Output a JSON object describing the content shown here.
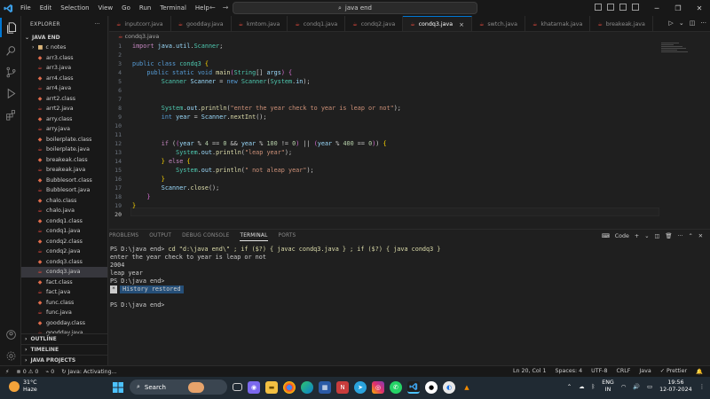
{
  "titlebar": {
    "menu": [
      "File",
      "Edit",
      "Selection",
      "View",
      "Go",
      "Run",
      "Terminal",
      "Help"
    ],
    "search_text": "java end"
  },
  "sidebar": {
    "header": "EXPLORER",
    "root": "JAVA END",
    "folder": "c notes",
    "files": [
      {
        "name": "arr3.class",
        "kind": "class"
      },
      {
        "name": "arr3.java",
        "kind": "java"
      },
      {
        "name": "arr4.class",
        "kind": "class"
      },
      {
        "name": "arr4.java",
        "kind": "java"
      },
      {
        "name": "arrt2.class",
        "kind": "class"
      },
      {
        "name": "arrt2.java",
        "kind": "java"
      },
      {
        "name": "arry.class",
        "kind": "class"
      },
      {
        "name": "arry.java",
        "kind": "java"
      },
      {
        "name": "boilerplate.class",
        "kind": "class"
      },
      {
        "name": "boilerplate.java",
        "kind": "java"
      },
      {
        "name": "breakeak.class",
        "kind": "class"
      },
      {
        "name": "breakeak.java",
        "kind": "java"
      },
      {
        "name": "Bubblesort.class",
        "kind": "class"
      },
      {
        "name": "Bubblesort.java",
        "kind": "java"
      },
      {
        "name": "chalo.class",
        "kind": "class"
      },
      {
        "name": "chalo.java",
        "kind": "java"
      },
      {
        "name": "condq1.class",
        "kind": "class"
      },
      {
        "name": "condq1.java",
        "kind": "java"
      },
      {
        "name": "condq2.class",
        "kind": "class"
      },
      {
        "name": "condq2.java",
        "kind": "java"
      },
      {
        "name": "condq3.class",
        "kind": "class"
      },
      {
        "name": "condq3.java",
        "kind": "java"
      },
      {
        "name": "fact.class",
        "kind": "class"
      },
      {
        "name": "fact.java",
        "kind": "java"
      },
      {
        "name": "func.class",
        "kind": "class"
      },
      {
        "name": "func.java",
        "kind": "java"
      },
      {
        "name": "goodday.class",
        "kind": "class"
      },
      {
        "name": "goodday.java",
        "kind": "java"
      }
    ],
    "selected_index": 21,
    "bottom_sections": [
      "OUTLINE",
      "TIMELINE",
      "JAVA PROJECTS"
    ]
  },
  "tabs": [
    {
      "label": "inputcorr.java",
      "active": false
    },
    {
      "label": "goodday.java",
      "active": false
    },
    {
      "label": "kmtom.java",
      "active": false
    },
    {
      "label": "condq1.java",
      "active": false
    },
    {
      "label": "condq2.java",
      "active": false
    },
    {
      "label": "condq3.java",
      "active": true
    },
    {
      "label": "swtch.java",
      "active": false
    },
    {
      "label": "khatarnak.java",
      "active": false
    },
    {
      "label": "breakeak.java",
      "active": false
    }
  ],
  "breadcrumb": "condq3.java",
  "code_lines": [
    "1",
    "2",
    "3",
    "4",
    "5",
    "6",
    "7",
    "8",
    "9",
    "10",
    "11",
    "12",
    "13",
    "14",
    "15",
    "16",
    "17",
    "18",
    "19",
    "20"
  ],
  "panel": {
    "tabs": [
      "PROBLEMS",
      "OUTPUT",
      "DEBUG CONSOLE",
      "TERMINAL",
      "PORTS"
    ],
    "active_tab": "TERMINAL",
    "shell_label": "Code",
    "terminal": {
      "prompt1": "PS D:\\java end> ",
      "cmd1": "cd \"d:\\java end\\\" ; if ($?) { javac condq3.java } ; if ($?) { java condq3 }",
      "out1": "enter the year check to year is leap or not",
      "out2": "2004",
      "out3": "leap year",
      "prompt2": "PS D:\\java end>",
      "history_star": "*",
      "history": "History restored",
      "prompt3": "PS D:\\java end>"
    }
  },
  "statusbar": {
    "errors": "0",
    "warnings": "0",
    "ports": "0",
    "java_status": "Java: Activating...",
    "position": "Ln 20, Col 1",
    "spaces": "Spaces: 4",
    "encoding": "UTF-8",
    "eol": "CRLF",
    "language": "Java",
    "prettier": "Prettier"
  },
  "taskbar": {
    "temp": "31°C",
    "weather": "Haze",
    "search": "Search",
    "lang1": "ENG",
    "lang2": "IN",
    "time": "19:56",
    "date": "12-07-2024",
    "colors": {
      "bg": "#202a33",
      "accent": "#0078d4"
    }
  }
}
